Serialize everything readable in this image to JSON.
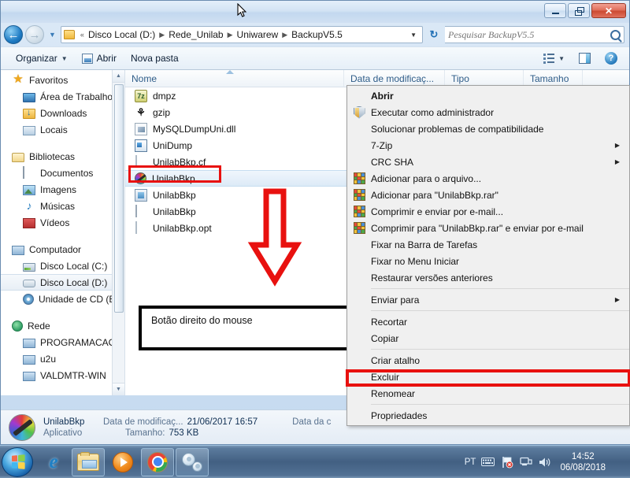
{
  "window": {
    "controls": {
      "minimize": "minimize",
      "restore": "restore",
      "close": "✕"
    }
  },
  "address": {
    "back_icon": "back-arrow-icon",
    "forward_icon": "forward-arrow-icon",
    "history_icon": "history-dropdown-icon",
    "crumbs": [
      "Disco Local (D:)",
      "Rede_Unilab",
      "Uniwarew",
      "BackupV5.5"
    ],
    "overflow": "«",
    "separator": "▶",
    "dropdown": "▼",
    "refresh_icon": "refresh-icon",
    "refresh_glyph": "↻"
  },
  "search": {
    "placeholder": "Pesquisar BackupV5.5",
    "value": ""
  },
  "toolbar": {
    "organize": "Organizar",
    "open": "Abrir",
    "new_folder": "Nova pasta",
    "caret": "▼",
    "views_icon": "view-options-icon",
    "preview_icon": "preview-pane-icon",
    "help_icon": "help-icon",
    "help_glyph": "?"
  },
  "sidebar": {
    "groups": [
      {
        "header": {
          "label": "Favoritos",
          "icon": "star-icon"
        },
        "items": [
          {
            "label": "Área de Trabalho",
            "icon": "desktop-icon"
          },
          {
            "label": "Downloads",
            "icon": "downloads-icon"
          },
          {
            "label": "Locais",
            "icon": "places-icon"
          }
        ]
      },
      {
        "header": {
          "label": "Bibliotecas",
          "icon": "libraries-icon"
        },
        "items": [
          {
            "label": "Documentos",
            "icon": "documents-icon"
          },
          {
            "label": "Imagens",
            "icon": "pictures-icon"
          },
          {
            "label": "Músicas",
            "icon": "music-icon"
          },
          {
            "label": "Vídeos",
            "icon": "videos-icon"
          }
        ]
      },
      {
        "header": {
          "label": "Computador",
          "icon": "computer-icon"
        },
        "items": [
          {
            "label": "Disco Local (C:)",
            "icon": "hard-drive-icon",
            "selected": false
          },
          {
            "label": "Disco Local (D:)",
            "icon": "hard-drive-icon",
            "selected": true
          },
          {
            "label": "Unidade de CD (E",
            "icon": "cd-drive-icon",
            "selected": false
          }
        ]
      },
      {
        "header": {
          "label": "Rede",
          "icon": "network-icon"
        },
        "items": [
          {
            "label": "PROGRAMACAO",
            "icon": "network-computer-icon"
          },
          {
            "label": "u2u",
            "icon": "network-computer-icon"
          },
          {
            "label": "VALDMTR-WIN",
            "icon": "network-computer-icon"
          }
        ]
      }
    ],
    "scroll_up": "▲",
    "scroll_down": "▼"
  },
  "filelist": {
    "columns": [
      "Nome",
      "Data de modificaç...",
      "Tipo",
      "Tamanho"
    ],
    "rows": [
      {
        "name": "dmpz",
        "icon": "seven-zip-icon",
        "selected": false
      },
      {
        "name": "gzip",
        "icon": "gzip-icon",
        "selected": false
      },
      {
        "name": "MySQLDumpUni.dll",
        "icon": "dll-icon",
        "selected": false
      },
      {
        "name": "UniDump",
        "icon": "application-icon",
        "selected": false
      },
      {
        "name": "UnilabBkp.cf",
        "icon": "blank-file-icon",
        "selected": false
      },
      {
        "name": "UnilabBkp",
        "icon": "color-wheel-app-icon",
        "selected": true
      },
      {
        "name": "UnilabBkp",
        "icon": "help-file-icon",
        "selected": false
      },
      {
        "name": "UnilabBkp",
        "icon": "text-file-icon",
        "selected": false
      },
      {
        "name": "UnilabBkp.opt",
        "icon": "blank-file-icon",
        "selected": false
      }
    ]
  },
  "annotations": {
    "note_text": "Botão direito do mouse",
    "arrow_icon": "red-down-arrow-icon",
    "selection_box_color": "#e8110f",
    "highlight_box_color": "#e8110f"
  },
  "context_menu": {
    "items": [
      {
        "label": "Abrir",
        "icon": "",
        "bold": true,
        "submenu": false,
        "sep_after": false
      },
      {
        "label": "Executar como administrador",
        "icon": "shield-icon",
        "bold": false,
        "submenu": false,
        "sep_after": false
      },
      {
        "label": "Solucionar problemas de compatibilidade",
        "icon": "",
        "bold": false,
        "submenu": false,
        "sep_after": false
      },
      {
        "label": "7-Zip",
        "icon": "",
        "bold": false,
        "submenu": true,
        "sep_after": false
      },
      {
        "label": "CRC SHA",
        "icon": "",
        "bold": false,
        "submenu": true,
        "sep_after": false
      },
      {
        "label": "Adicionar para o arquivo...",
        "icon": "winrar-icon",
        "bold": false,
        "submenu": false,
        "sep_after": false
      },
      {
        "label": "Adicionar para \"UnilabBkp.rar\"",
        "icon": "winrar-icon",
        "bold": false,
        "submenu": false,
        "sep_after": false
      },
      {
        "label": "Comprimir e enviar por e-mail...",
        "icon": "winrar-icon",
        "bold": false,
        "submenu": false,
        "sep_after": false
      },
      {
        "label": "Comprimir para \"UnilabBkp.rar\" e enviar por e-mail",
        "icon": "winrar-icon",
        "bold": false,
        "submenu": false,
        "sep_after": false
      },
      {
        "label": "Fixar na Barra de Tarefas",
        "icon": "",
        "bold": false,
        "submenu": false,
        "sep_after": false
      },
      {
        "label": "Fixar no Menu Iniciar",
        "icon": "",
        "bold": false,
        "submenu": false,
        "sep_after": false
      },
      {
        "label": "Restaurar versões anteriores",
        "icon": "",
        "bold": false,
        "submenu": false,
        "sep_after": true
      },
      {
        "label": "Enviar para",
        "icon": "",
        "bold": false,
        "submenu": true,
        "sep_after": true
      },
      {
        "label": "Recortar",
        "icon": "",
        "bold": false,
        "submenu": false,
        "sep_after": false
      },
      {
        "label": "Copiar",
        "icon": "",
        "bold": false,
        "submenu": false,
        "sep_after": true
      },
      {
        "label": "Criar atalho",
        "icon": "",
        "bold": false,
        "submenu": false,
        "sep_after": false,
        "highlighted": true
      },
      {
        "label": "Excluir",
        "icon": "",
        "bold": false,
        "submenu": false,
        "sep_after": false
      },
      {
        "label": "Renomear",
        "icon": "",
        "bold": false,
        "submenu": false,
        "sep_after": true
      },
      {
        "label": "Propriedades",
        "icon": "",
        "bold": false,
        "submenu": false,
        "sep_after": false
      }
    ],
    "submenu_arrow": "▶"
  },
  "statusbar": {
    "file_name": "UnilabBkp",
    "file_type": "Aplicativo",
    "modified_label": "Data de modificaç...",
    "modified_value": "21/06/2017 16:57",
    "size_label": "Tamanho:",
    "size_value": "753 KB",
    "created_label": "Data da c"
  },
  "taskbar": {
    "start_icon": "windows-start-orb-icon",
    "buttons": [
      {
        "icon": "internet-explorer-icon",
        "framed": false
      },
      {
        "icon": "file-explorer-icon",
        "framed": true
      },
      {
        "icon": "windows-media-player-icon",
        "framed": false
      },
      {
        "icon": "google-chrome-icon",
        "framed": true
      },
      {
        "icon": "settings-gears-icon",
        "framed": true
      }
    ],
    "tray": {
      "language": "PT",
      "keyboard_icon": "keyboard-icon",
      "flag_icon": "action-center-flag-icon",
      "network_icon": "network-icon",
      "volume_icon": "volume-icon",
      "volume_glyph": "🔊",
      "time": "14:52",
      "date": "06/08/2018"
    },
    "show_desktop": "show-desktop-button"
  }
}
